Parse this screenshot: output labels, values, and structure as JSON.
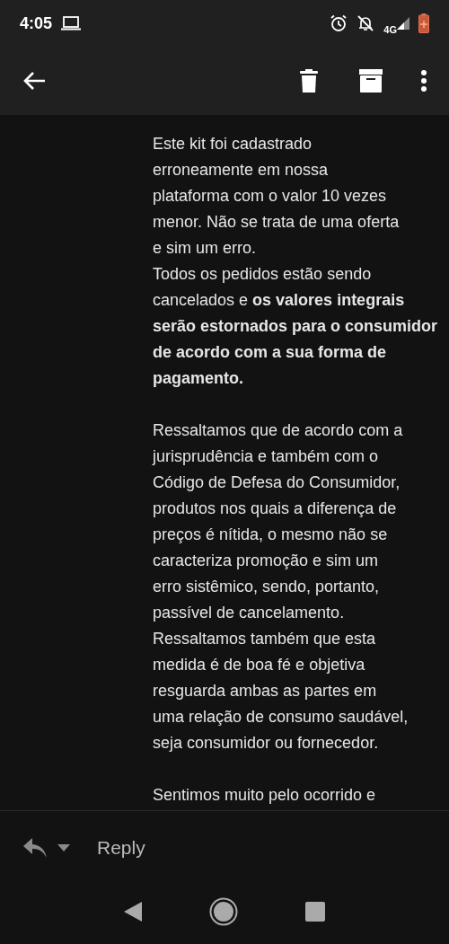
{
  "status_bar": {
    "time": "4:05",
    "network": "4G"
  },
  "body": {
    "blocks": [
      {
        "lines": [
          "Este kit foi cadastrado",
          "erroneamente em nossa",
          "plataforma com o valor 10 vezes",
          "menor. Não se trata de uma oferta",
          "e sim um erro.",
          "Todos os pedidos estão sendo",
          "cancelados e **os valores integrais**",
          "**serão estornados para o consumidor**",
          "**de acordo com a sua forma de**",
          "**pagamento.**"
        ]
      },
      {
        "lines": [
          "Ressaltamos que de acordo com a",
          "jurisprudência e também com o",
          "Código de Defesa do Consumidor,",
          "produtos nos quais a diferença de",
          "preços é nítida, o mesmo não se",
          "caracteriza promoção e sim um",
          "erro sistêmico, sendo, portanto,",
          "passível de cancelamento.",
          "Ressaltamos também que esta",
          "medida é de boa fé e objetiva",
          "resguarda ambas as partes em",
          "uma relação de consumo saudável,",
          "seja consumidor ou fornecedor."
        ]
      },
      {
        "lines": [
          "Sentimos muito pelo ocorrido e"
        ]
      }
    ]
  },
  "reply_bar": {
    "label": "Reply"
  }
}
